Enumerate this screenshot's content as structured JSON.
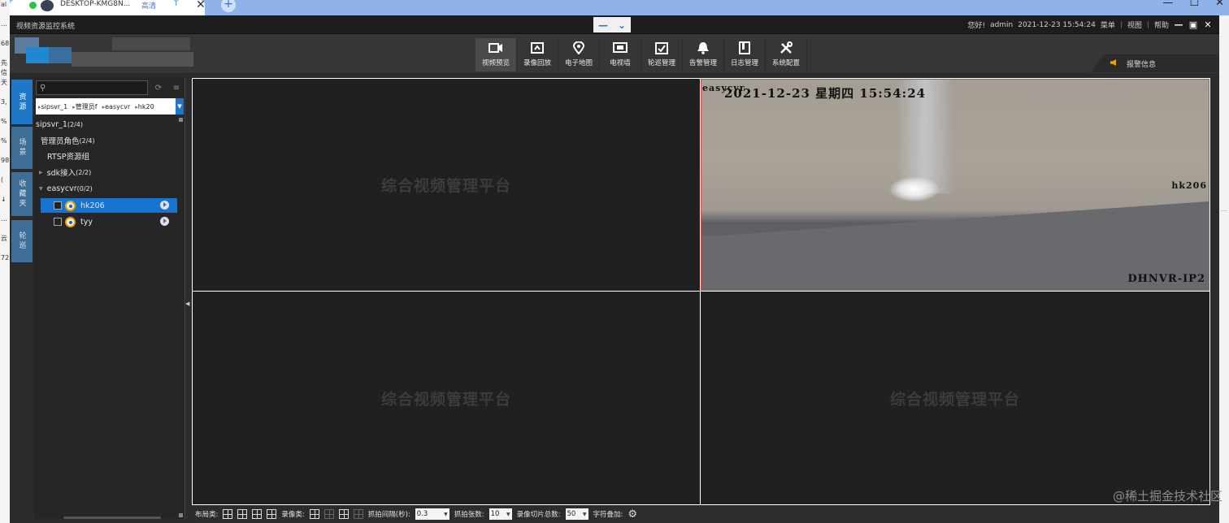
{
  "browser": {
    "left_fragments": [
      "al",
      "…",
      "68",
      "先信",
      "天",
      "3,",
      "%",
      "%",
      "98",
      "(",
      "↓",
      "…",
      "云",
      "72"
    ],
    "tab_title": "DESKTOP-KMG8N...",
    "tab_quality": "高清",
    "tab_extra": "T",
    "tab_close": "✕",
    "new_tab": "+",
    "minimize": "—",
    "maximize": "☐",
    "close": "✕"
  },
  "app": {
    "title": "视频资源监控系统",
    "window_box": {
      "minus": "—",
      "chevron": "⌄"
    },
    "greeting": "您好!",
    "user": "admin",
    "datetime": "2021-12-23 15:54:24",
    "menu_label": "菜单",
    "view_label": "视图",
    "help_label": "帮助",
    "win_min": "—",
    "win_max": "▣",
    "win_close": "✕"
  },
  "nav": {
    "items": [
      {
        "label": "视频预览",
        "icon": "video-camera-icon",
        "active": true
      },
      {
        "label": "录像回放",
        "icon": "playback-icon",
        "active": false
      },
      {
        "label": "电子地图",
        "icon": "map-pin-icon",
        "active": false
      },
      {
        "label": "电视墙",
        "icon": "tv-wall-icon",
        "active": false
      },
      {
        "label": "轮巡管理",
        "icon": "patrol-check-icon",
        "active": false
      },
      {
        "label": "告警管理",
        "icon": "bell-icon",
        "active": false
      },
      {
        "label": "日志管理",
        "icon": "log-book-icon",
        "active": false
      },
      {
        "label": "系统配置",
        "icon": "tools-icon",
        "active": false
      }
    ],
    "alarm_label": "报警信息"
  },
  "sidetabs": [
    {
      "label": "资源",
      "active": true
    },
    {
      "label": "场景",
      "active": false
    },
    {
      "label": "收藏夹",
      "active": false
    },
    {
      "label": "轮巡",
      "active": false
    }
  ],
  "tree": {
    "search_value": "",
    "refresh_icon": "⟳",
    "list_icon": "≡",
    "breadcrumbs": [
      "sipsvr_1",
      "管理员f",
      "easycvr",
      "hk20"
    ],
    "nodes": [
      {
        "label": "sipsvr_1",
        "count": "(2/4)"
      },
      {
        "label": "管理员角色",
        "count": "(2/4)"
      },
      {
        "label": "RTSP资源组",
        "count": ""
      },
      {
        "label": "sdk接入",
        "count": "(2/2)"
      },
      {
        "label": "easycvr",
        "count": "(0/2)"
      }
    ],
    "devices": [
      {
        "label": "hk206",
        "selected": true
      },
      {
        "label": "tyy",
        "selected": false
      }
    ]
  },
  "video": {
    "placeholder": "综合视频管理平台",
    "live": {
      "osd_channel": "easycvr",
      "osd_datetime": "2021-12-23  星期四  15:54:24",
      "osd_name": "hk206",
      "osd_device": "DHNVR-IP2"
    }
  },
  "bottombar": {
    "layout_label": "布局类:",
    "record_label": "录像类:",
    "capture_interval_label": "抓拍间隔(秒):",
    "capture_interval_value": "0.3",
    "capture_count_label": "抓拍张数:",
    "capture_count_value": "10",
    "slice_total_label": "录像切片总数:",
    "slice_total_value": "50",
    "overlay_label": "字符叠加:",
    "dropdown_arrow": "▼",
    "gear_icon": "⚙"
  },
  "watermark": "@稀土掘金技术社区",
  "colors": {
    "accent_blue": "#1f77c7",
    "selected_row": "#1773d0",
    "active_cell_border": "#d04848",
    "alarm_orange": "#f0a000"
  }
}
